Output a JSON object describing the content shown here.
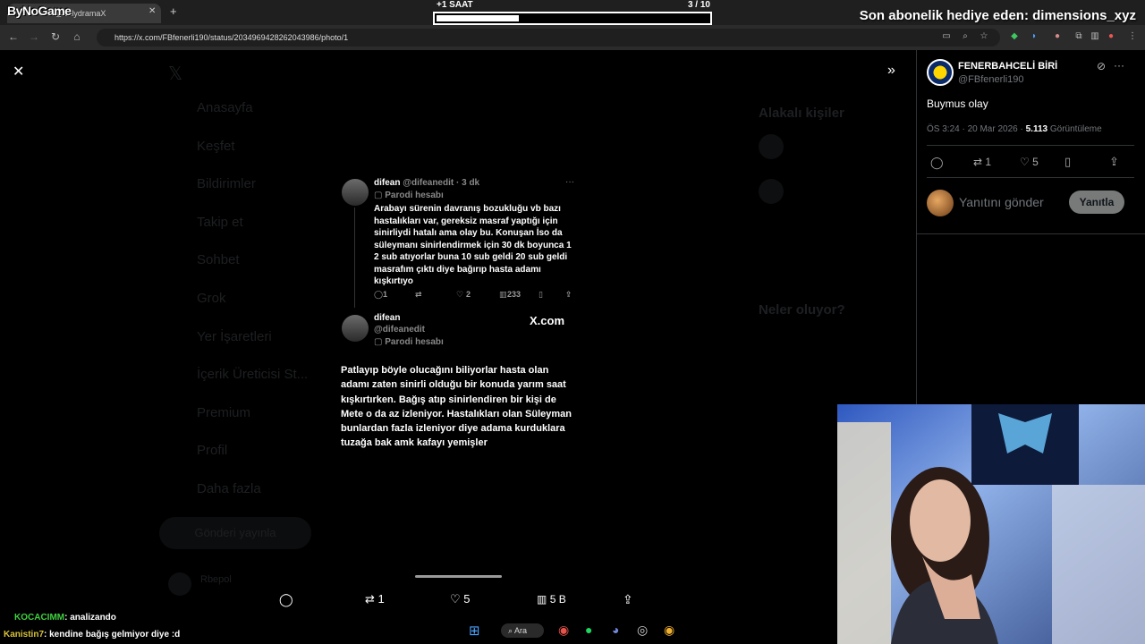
{
  "overlay": {
    "brand": "ByNoGame",
    "timer_label": "+1 SAAT",
    "counter": "3 / 10",
    "progress_fraction": 0.3,
    "last_gift": "Son abonelik hediye eden: dimensions_xyz"
  },
  "browser": {
    "tab_title": "\"@onlydramaX",
    "url": "https://x.com/FBfenerli190/status/2034969428262043986/photo/1"
  },
  "background": {
    "nav": [
      "Anasayfa",
      "Keşfet",
      "Bildirimler",
      "Takip et",
      "Sohbet",
      "Grok",
      "Yer İşaretleri",
      "İçerik Üreticisi St...",
      "Premium",
      "Profil",
      "Daha fazla"
    ],
    "post_button": "Gönderi yayınla",
    "profile_name": "Rbepol",
    "related": "Alakalı kişiler",
    "news": "Neler oluyor?"
  },
  "photo": {
    "tweet1": {
      "name": "difean",
      "handle": "@difeanedit · 3 dk",
      "badge": "Parodi hesabı",
      "body": "Arabayı sürenin davranış bozukluğu vb bazı hastalıkları var, gereksiz masraf yaptığı için sinirliydi hatalı ama olay bu. Konuşan İso da süleymanı sinirlendirmek için 30 dk boyunca 1 2 sub atıyorlar buna 10 sub geldi 20 sub geldi masrafım çıktı diye bağırıp hasta adamı kışkırtıyo",
      "replies": "1",
      "likes": "2",
      "views": "233"
    },
    "tweet2": {
      "name": "difean",
      "handle": "@difeanedit",
      "badge": "Parodi hesabı",
      "watermark": "X.com",
      "body": "Patlayıp böyle olucağını biliyorlar hasta olan adamı zaten sinirli olduğu bir konuda yarım saat kışkırtırken. Bağış atıp sinirlendiren bir kişi de Mete o da az izleniyor. Hastalıkları olan Süleyman bunlardan fazla izleniyor diye adama kurduklara tuzağa bak amk kafayı yemişler"
    }
  },
  "bottom_bar": {
    "retweets": "1",
    "likes": "5",
    "views": "5 B"
  },
  "side": {
    "name": "FENERBAHCELİ BİRİ",
    "handle": "@FBfenerli190",
    "text": "Buymus olay",
    "time": "ÖS 3:24 · 20 Mar 2026 ·",
    "views_count": "5.113",
    "views_label": "Görüntüleme",
    "retweets": "1",
    "likes": "5",
    "reply_placeholder": "Yanıtını gönder",
    "reply_button": "Yanıtla"
  },
  "chat": [
    {
      "user": "KOCACIMM",
      "msg": ": analizando",
      "color": "#3fd13f"
    },
    {
      "user": "Kanistin7",
      "msg": ": kendine bağış gelmiyor diye :d",
      "color": "#d8c23a"
    }
  ],
  "taskbar": {
    "search": "Ara"
  }
}
